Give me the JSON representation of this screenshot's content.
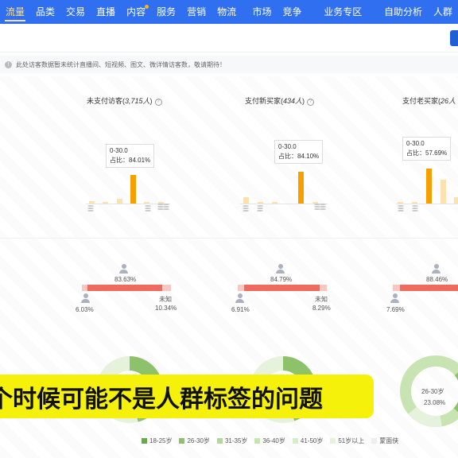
{
  "nav": {
    "items": [
      "流量",
      "品类",
      "交易",
      "直播",
      "内容",
      "服务",
      "营销",
      "物流"
    ],
    "items2": [
      "市场",
      "竞争"
    ],
    "items3": [
      "业务专区"
    ],
    "items4": [
      "自助分析",
      "人群"
    ]
  },
  "notice": {
    "text": "此处访客数据暂未统计直播间、短视频、图文、微详情访客数，敬请期待！"
  },
  "columns": [
    {
      "title_prefix": "未支付访客(",
      "title_count": "3,715人",
      "title_suffix": ")",
      "tooltip_range": "0-30.0",
      "tooltip_share": "占比：84.01%",
      "male_pct": "83.63%",
      "female_pct": "6.03%",
      "unknown_label": "未知",
      "unknown_pct": "10.34%"
    },
    {
      "title_prefix": "支付新买家(",
      "title_count": "434人",
      "title_suffix": ")",
      "tooltip_range": "0-30.0",
      "tooltip_share": "占比：84.10%",
      "male_pct": "84.79%",
      "female_pct": "6.91%",
      "unknown_label": "未知",
      "unknown_pct": "8.29%"
    },
    {
      "title_prefix": "支付老买家(",
      "title_count": "26人",
      "title_suffix": "",
      "tooltip_range": "0-30.0",
      "tooltip_share": "占比：57.69%",
      "male_pct": "88.46%",
      "female_pct": "7.69%",
      "unknown_label": "",
      "unknown_pct": ""
    }
  ],
  "donut3": {
    "label": "26-30岁",
    "value": "23.08%"
  },
  "legend": [
    {
      "label": "18-25岁",
      "color": "#6aa84f"
    },
    {
      "label": "26-30岁",
      "color": "#8dc26b"
    },
    {
      "label": "31-35岁",
      "color": "#b3d99a"
    },
    {
      "label": "36-40岁",
      "color": "#c9e4b3"
    },
    {
      "label": "41-50岁",
      "color": "#d9ecc9"
    },
    {
      "label": "51岁以上",
      "color": "#e6f2dc"
    },
    {
      "label": "蒙面侠",
      "color": "#eeeeee"
    }
  ],
  "colors": {
    "nav_bg": "#2f6ff0",
    "bar_main": "#f5a000",
    "bar_light": "#fde2b0",
    "male": "#ee6b5e",
    "female_bar": "#f8c7c1",
    "caption_bg": "#f5f10a"
  },
  "caption": {
    "text": "个时候可能不是人群标签的问题"
  }
}
